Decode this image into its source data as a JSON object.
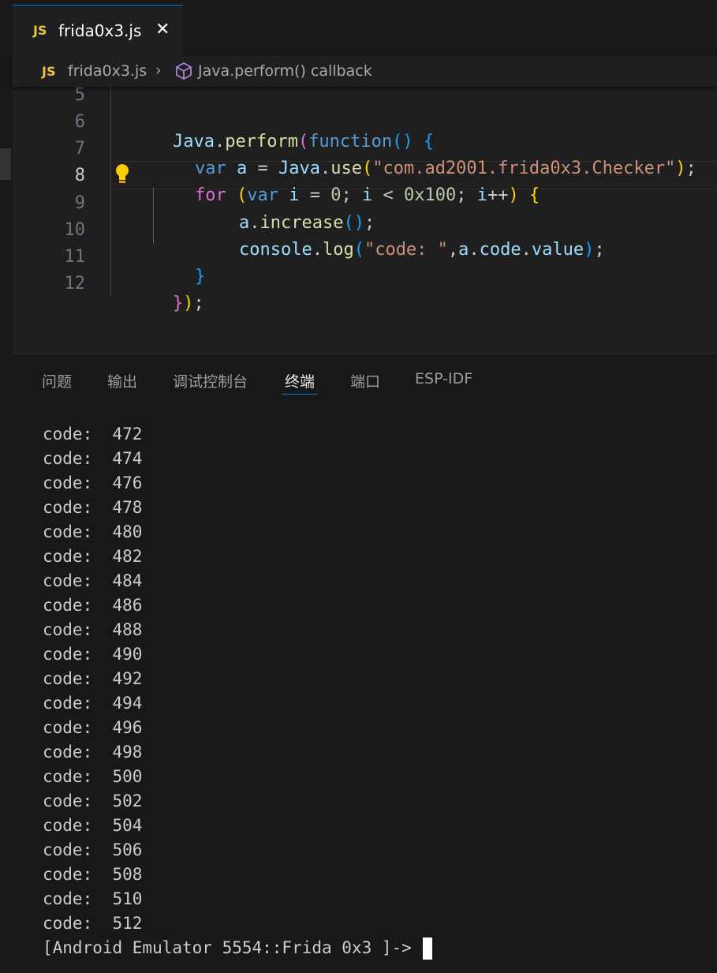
{
  "tab": {
    "icon_label": "JS",
    "filename": "frida0x3.js",
    "close_glyph": "✕"
  },
  "breadcrumb": {
    "icon_label": "JS",
    "file": "frida0x3.js",
    "separator": "›",
    "symbol": "Java.perform() callback"
  },
  "editor": {
    "line_numbers": [
      "5",
      "6",
      "7",
      "8",
      "9",
      "10",
      "11",
      "12"
    ],
    "active_line": "8",
    "lines": {
      "l6": [
        "Java",
        ".",
        "perform",
        "(",
        "function",
        "()",
        " {"
      ],
      "l7": [
        "var",
        " ",
        "a",
        " = ",
        "Java",
        ".",
        "use",
        "(",
        "\"com.ad2001.frida0x3.Checker\"",
        ")",
        ";"
      ],
      "l8": [
        "for",
        " ",
        "(",
        "var",
        " ",
        "i",
        " = ",
        "0",
        "; ",
        "i",
        " < ",
        "0x100",
        "; ",
        "i",
        "++",
        ")",
        " {"
      ],
      "l9": [
        "a",
        ".",
        "increase",
        "()",
        ";"
      ],
      "l10": [
        "console",
        ".",
        "log",
        "(",
        "\"code: \"",
        ",",
        "a",
        ".",
        "code",
        ".",
        "value",
        ")",
        ";"
      ],
      "l11": [
        "}"
      ],
      "l12": [
        "}",
        ")",
        ";"
      ]
    }
  },
  "panel": {
    "tabs": [
      "问题",
      "输出",
      "调试控制台",
      "终端",
      "端口",
      "ESP-IDF"
    ],
    "active_tab": "终端",
    "terminal": {
      "label": "code: ",
      "values": [
        "472",
        "474",
        "476",
        "478",
        "480",
        "482",
        "484",
        "486",
        "488",
        "490",
        "492",
        "494",
        "496",
        "498",
        "500",
        "502",
        "504",
        "506",
        "508",
        "510",
        "512"
      ],
      "prompt": "[Android Emulator 5554::Frida 0x3 ]->"
    }
  },
  "icons": {
    "tab": "js-file-icon",
    "close": "close-icon",
    "breadcrumb_symbol": "method-cube-icon",
    "hint": "lightbulb-icon"
  }
}
